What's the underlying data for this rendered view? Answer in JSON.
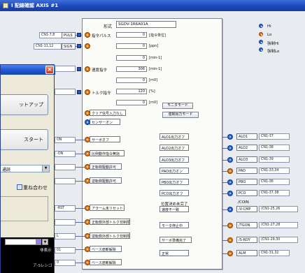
{
  "window": {
    "title": "I 配線確認 AXIS #1"
  },
  "model": {
    "label": "形式",
    "value": "SGDV-1R6A01A"
  },
  "top_params": [
    {
      "label": "指令パルス",
      "value": "0",
      "unit": "[指令単位]"
    },
    {
      "label": "",
      "value": "0",
      "unit": "[ppn]"
    },
    {
      "label": "",
      "value": "0",
      "unit": "[min-1]"
    },
    {
      "label": "速度指令",
      "value": "306",
      "unit": "[min-1]"
    },
    {
      "label": "",
      "value": "0",
      "unit": "[mV]"
    },
    {
      "label": "トルク指令",
      "value": "120",
      "unit": "[%]"
    },
    {
      "label": "",
      "value": "0",
      "unit": "[mV]"
    }
  ],
  "left_ports": [
    {
      "cn": "CN1-7,8",
      "name": "PULS"
    },
    {
      "cn": "CN1-11,12",
      "name": "SIGN"
    }
  ],
  "inputs": [
    {
      "label": "クリア信号入力なし"
    },
    {
      "label": "センサーオン"
    },
    {
      "label": "サーボオフ",
      "pin": "ON"
    },
    {
      "label": "比例動作指令無効",
      "pin": "-ON"
    },
    {
      "label": "正転側駆動許可",
      "pin": ""
    },
    {
      "label": "逆転側駆動許可",
      "pin": ""
    },
    {
      "label": "アラーム未リセット",
      "pin": "-RST"
    },
    {
      "label": "正転側外部トルク非制限",
      "pin": ""
    },
    {
      "label": "逆転側外部トルク非制限",
      "pin": "L"
    },
    {
      "label": "ベース遮断解除",
      "pin": "01"
    },
    {
      "label": "ベース遮断解除",
      "pin": "0"
    }
  ],
  "monitor_buttons": [
    {
      "label": "モニタモード"
    },
    {
      "label": "強制出力モード"
    }
  ],
  "outputs": [
    {
      "label": "ALO1出力オフ",
      "sig": "ALO1",
      "cn": "CN1-37"
    },
    {
      "label": "ALO2出力オフ",
      "sig": "ALO2",
      "cn": "CN1-38"
    },
    {
      "label": "ALO3出力オフ",
      "sig": "ALO3",
      "cn": "CN1-39"
    },
    {
      "label": "PAO出力オン",
      "sig": "PAO",
      "cn": "CN1-33,34"
    },
    {
      "label": "PBO出力オフ",
      "sig": "PBO",
      "cn": "CN1-36"
    },
    {
      "label": "PCO出力オフ",
      "sig": "PCO",
      "cn": "CN1-37,38"
    },
    {
      "label": "位置決め未完了",
      "label2": "速度不一致",
      "sig": "/COIN",
      "sig2": "/V-CMP",
      "cn": "(CN1-25,26"
    },
    {
      "label": "モータ停止中",
      "sig": "/TGON",
      "cn": "(CN1-27,28"
    },
    {
      "label": "サーボ準備完了",
      "sig": "/S-RDY",
      "cn": "(CN1-29,30"
    },
    {
      "label": "正常",
      "sig": "ALM",
      "cn": "CN1-31,32"
    }
  ],
  "legend": [
    {
      "label": "Hi"
    },
    {
      "label": "Lo"
    },
    {
      "label": "強制Hi"
    },
    {
      "label": "強制Lo"
    }
  ],
  "dialog": {
    "buttons": [
      {
        "label": "ットアップ"
      },
      {
        "label": "スタート"
      }
    ],
    "select_value": "通読",
    "overlay_label": "重ね合わせ",
    "footer_text": "非表示",
    "footer_text2": "ア-Sレシゴ"
  },
  "colors": {
    "accent": "#2b52b8",
    "title_bar": "#1f55d0",
    "port_orange": "#e07a16"
  }
}
